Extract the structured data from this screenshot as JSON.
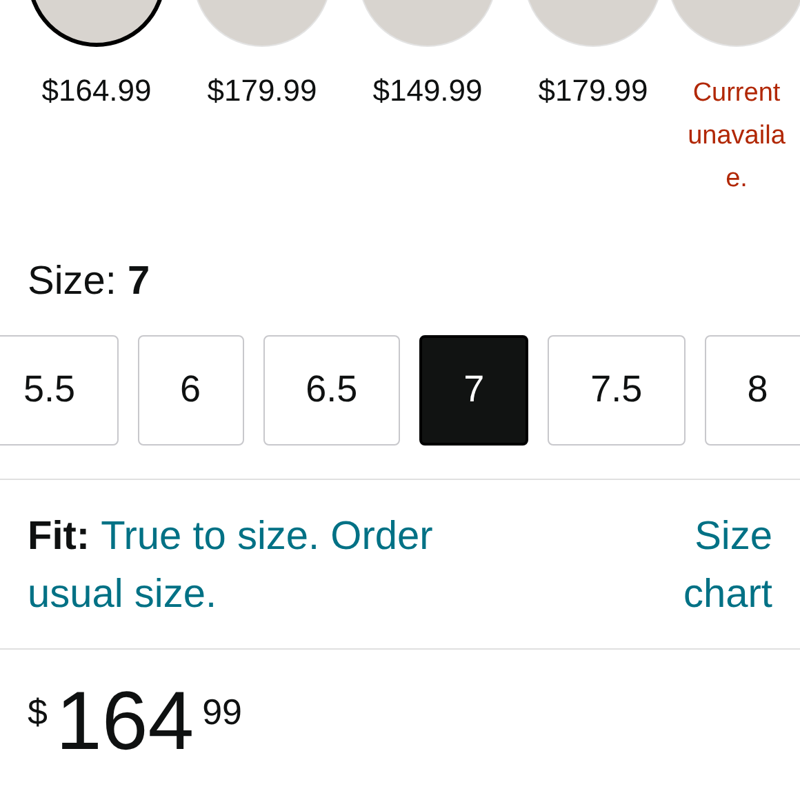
{
  "swatches": [
    {
      "price": "$164.99",
      "selected": true,
      "kind": "price"
    },
    {
      "price": "$179.99",
      "selected": false,
      "kind": "price"
    },
    {
      "price": "$149.99",
      "selected": false,
      "kind": "price"
    },
    {
      "price": "$179.99",
      "selected": false,
      "kind": "price"
    },
    {
      "price": "Current\nunavaila\ne.",
      "selected": false,
      "kind": "unavailable"
    }
  ],
  "size": {
    "label": "Size:",
    "value": "7"
  },
  "sizes": [
    {
      "label": "5.5",
      "selected": false
    },
    {
      "label": "6",
      "selected": false
    },
    {
      "label": "6.5",
      "selected": false
    },
    {
      "label": "7",
      "selected": true
    },
    {
      "label": "7.5",
      "selected": false
    },
    {
      "label": "8",
      "selected": false
    }
  ],
  "fit": {
    "label": "Fit:",
    "text": "True to size. Order usual size.",
    "link": "Size chart"
  },
  "price": {
    "currency": "$",
    "whole": "164",
    "fraction": "99"
  }
}
